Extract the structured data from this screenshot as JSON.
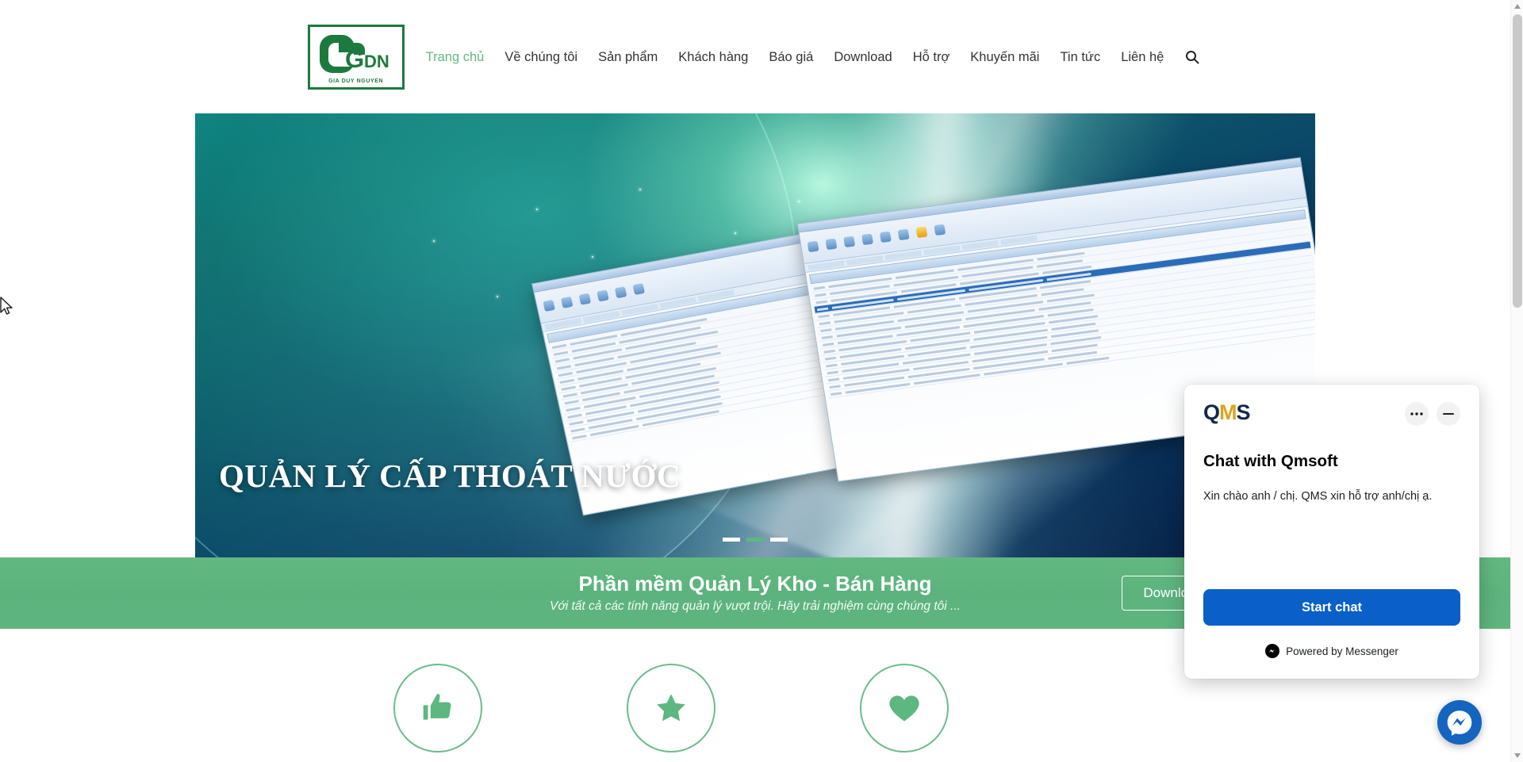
{
  "brand": {
    "logo_letters": "GDN",
    "logo_subtitle": "GIA DUY NGUYEN"
  },
  "nav": {
    "items": [
      {
        "label": "Trang chủ",
        "active": true
      },
      {
        "label": "Về chúng tôi",
        "active": false
      },
      {
        "label": "Sản phẩm",
        "active": false
      },
      {
        "label": "Khách hàng",
        "active": false
      },
      {
        "label": "Báo giá",
        "active": false
      },
      {
        "label": "Download",
        "active": false
      },
      {
        "label": "Hỗ trợ",
        "active": false
      },
      {
        "label": "Khuyến mãi",
        "active": false
      },
      {
        "label": "Tin tức",
        "active": false
      },
      {
        "label": "Liên hệ",
        "active": false
      }
    ],
    "search_icon": "search-icon"
  },
  "hero": {
    "title": "QUẢN LÝ CẤP THOÁT NƯỚC",
    "slides_total": 3,
    "active_slide": 2,
    "accent_color": "#5cb87f"
  },
  "promo": {
    "title": "Phần mềm Quản Lý Kho - Bán Hàng",
    "subtitle": "Với tất cả các tính năng quản lý vượt trội. Hãy trải nghiệm cùng chúng tôi ...",
    "button_label": "Download",
    "background_color": "#5fb57e"
  },
  "features": [
    {
      "icon": "thumbs-up-icon"
    },
    {
      "icon": "star-icon"
    },
    {
      "icon": "heart-icon"
    }
  ],
  "chat": {
    "logo_text_a": "Q",
    "logo_text_m": "M",
    "logo_text_s": "S",
    "menu_icon": "ellipsis-icon",
    "minimize_icon": "minimize-icon",
    "title": "Chat with Qmsoft",
    "message": "Xin chào anh / chị. QMS xin hỗ trợ anh/chị ạ.",
    "start_button": "Start chat",
    "powered_by": "Powered by Messenger",
    "button_color": "#0a5fc9"
  },
  "fab": {
    "icon": "messenger-icon"
  }
}
